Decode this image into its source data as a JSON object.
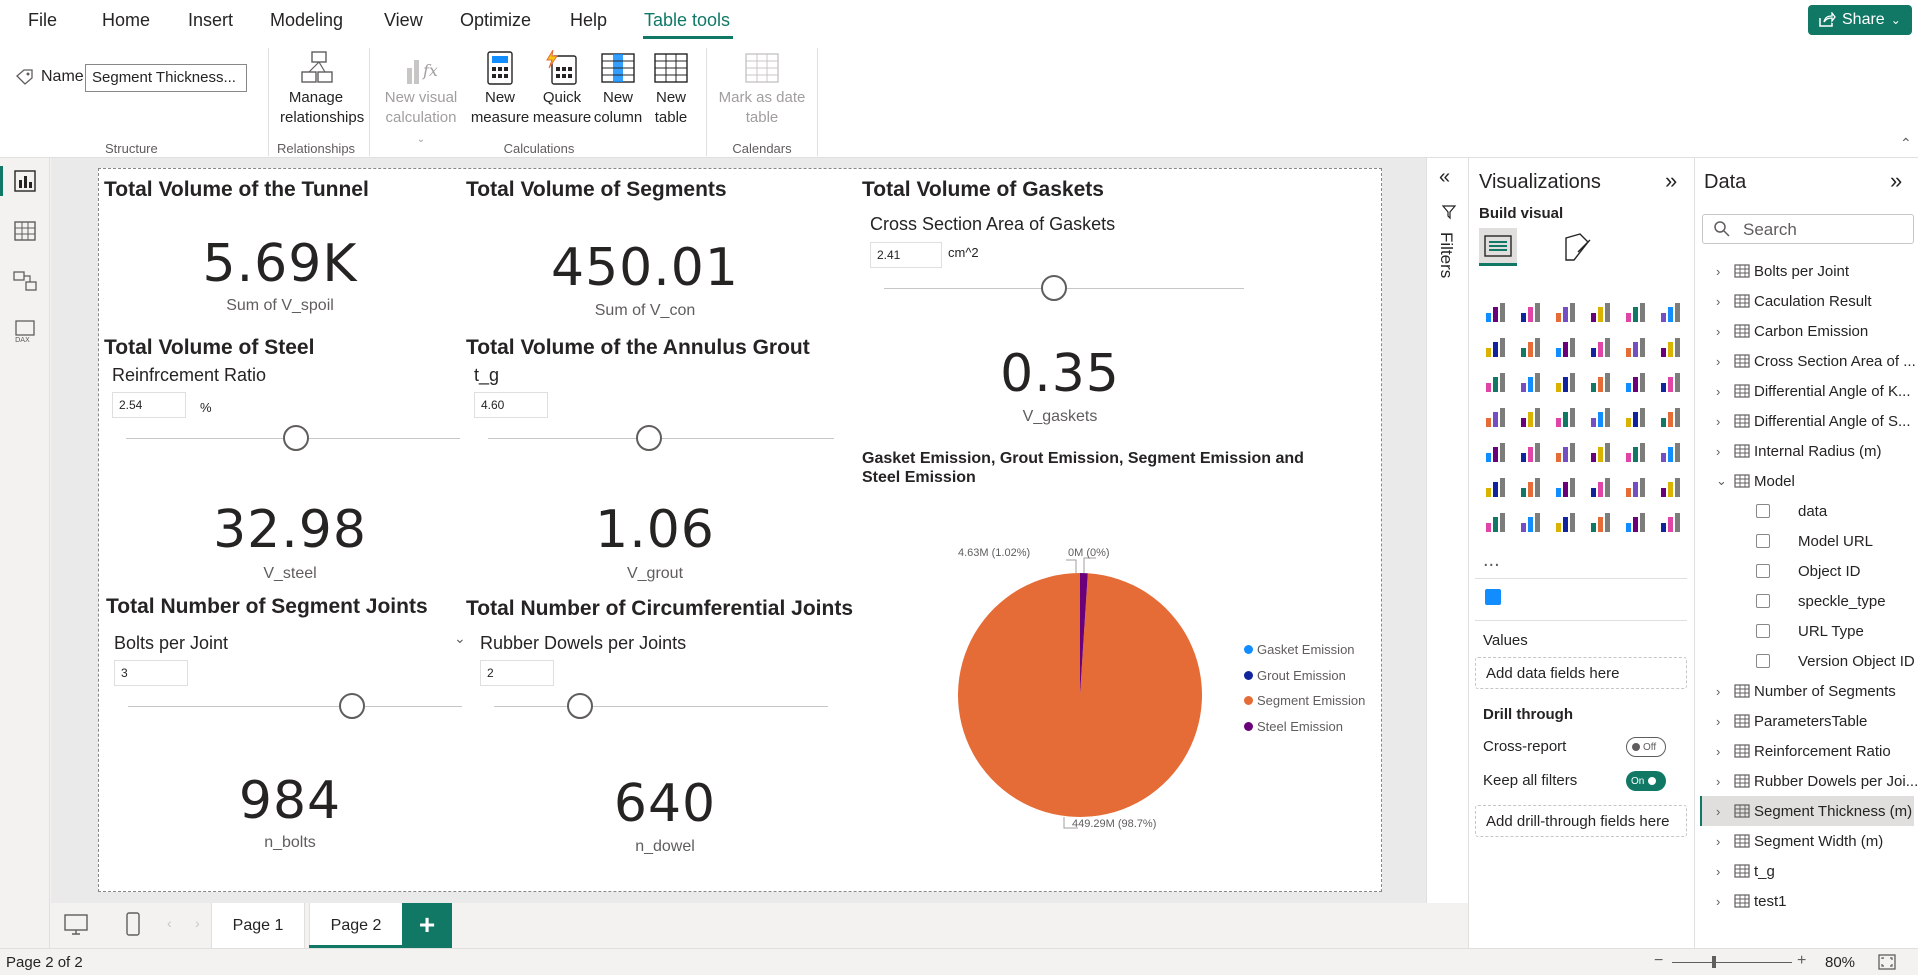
{
  "menu": {
    "file": "File",
    "home": "Home",
    "insert": "Insert",
    "modeling": "Modeling",
    "view": "View",
    "optimize": "Optimize",
    "help": "Help",
    "table_tools": "Table tools",
    "share": "Share"
  },
  "ribbon": {
    "name_label": "Name",
    "name_value": "Segment Thickness...",
    "structure": "Structure",
    "manage_relationships_1": "Manage",
    "manage_relationships_2": "relationships",
    "relationships": "Relationships",
    "new_visual_calc_1": "New visual",
    "new_visual_calc_2": "calculation",
    "new_measure_1": "New",
    "new_measure_2": "measure",
    "quick_measure_1": "Quick",
    "quick_measure_2": "measure",
    "new_column_1": "New",
    "new_column_2": "column",
    "new_table_1": "New",
    "new_table_2": "table",
    "calculations": "Calculations",
    "mark_date_1": "Mark as date",
    "mark_date_2": "table",
    "calendars": "Calendars"
  },
  "cards": {
    "tunnel": {
      "title": "Total Volume of the Tunnel",
      "value": "5.69K",
      "label": "Sum of V_spoil"
    },
    "segments": {
      "title": "Total Volume of Segments",
      "value": "450.01",
      "label": "Sum of V_con"
    },
    "gaskets": {
      "title": "Total Volume of Gaskets",
      "slicer": "Cross Section Area of Gaskets",
      "input": "2.41",
      "unit": "cm^2",
      "value": "0.35",
      "label": "V_gaskets"
    },
    "steel": {
      "title": "Total Volume of Steel",
      "slicer": "Reinfrcement Ratio",
      "input": "2.54",
      "unit": "%",
      "value": "32.98",
      "label": "V_steel"
    },
    "grout": {
      "title": "Total Volume of the Annulus Grout",
      "slicer": "t_g",
      "input": "4.60",
      "value": "1.06",
      "label": "V_grout"
    },
    "segjoints": {
      "title": "Total Number of Segment Joints",
      "slicer": "Bolts per Joint",
      "input": "3",
      "value": "984",
      "label": "n_bolts"
    },
    "circjoints": {
      "title": "Total Number of Circumferential Joints",
      "slicer": "Rubber Dowels per Joints",
      "input": "2",
      "value": "640",
      "label": "n_dowel"
    }
  },
  "chart_data": {
    "type": "pie",
    "title": "Gasket Emission, Grout Emission, Segment Emission and Steel Emission",
    "categories": [
      "Gasket Emission",
      "Grout Emission",
      "Segment Emission",
      "Steel Emission"
    ],
    "values": [
      0,
      0,
      449.29,
      4.63
    ],
    "unit": "M",
    "data_labels": [
      "0M (0%)",
      "449.29M (98.7%)",
      "4.63M (1.02%)"
    ],
    "colors": [
      "#118dff",
      "#12239e",
      "#e66c37",
      "#6b007b"
    ],
    "legend": "right"
  },
  "filters": {
    "label": "Filters"
  },
  "viz": {
    "title": "Visualizations",
    "build_visual": "Build visual",
    "values": "Values",
    "add_data_fields": "Add data fields here",
    "drill_through": "Drill through",
    "cross_report": "Cross-report",
    "cross_report_state": "Off",
    "keep_all_filters": "Keep all filters",
    "keep_all_filters_state": "On",
    "add_drill_fields": "Add drill-through fields here",
    "more": "..."
  },
  "data": {
    "title": "Data",
    "search_placeholder": "Search",
    "items": [
      "Bolts per Joint",
      "Caculation Result",
      "Carbon Emission",
      "Cross Section Area of ...",
      "Differential Angle of K...",
      "Differential Angle of S...",
      "Internal Radius (m)",
      "Model"
    ],
    "model_fields": [
      "data",
      "Model URL",
      "Object ID",
      "speckle_type",
      "URL Type",
      "Version Object ID"
    ],
    "items_after": [
      "Number of Segments",
      "ParametersTable",
      "Reinforcement Ratio",
      "Rubber Dowels per Joi...",
      "Segment Thickness (m)",
      "Segment Width (m)",
      "t_g",
      "test1"
    ]
  },
  "pages": {
    "page1": "Page 1",
    "page2": "Page 2",
    "add": "+"
  },
  "status": {
    "page_info": "Page 2 of 2",
    "zoom": "80%"
  }
}
